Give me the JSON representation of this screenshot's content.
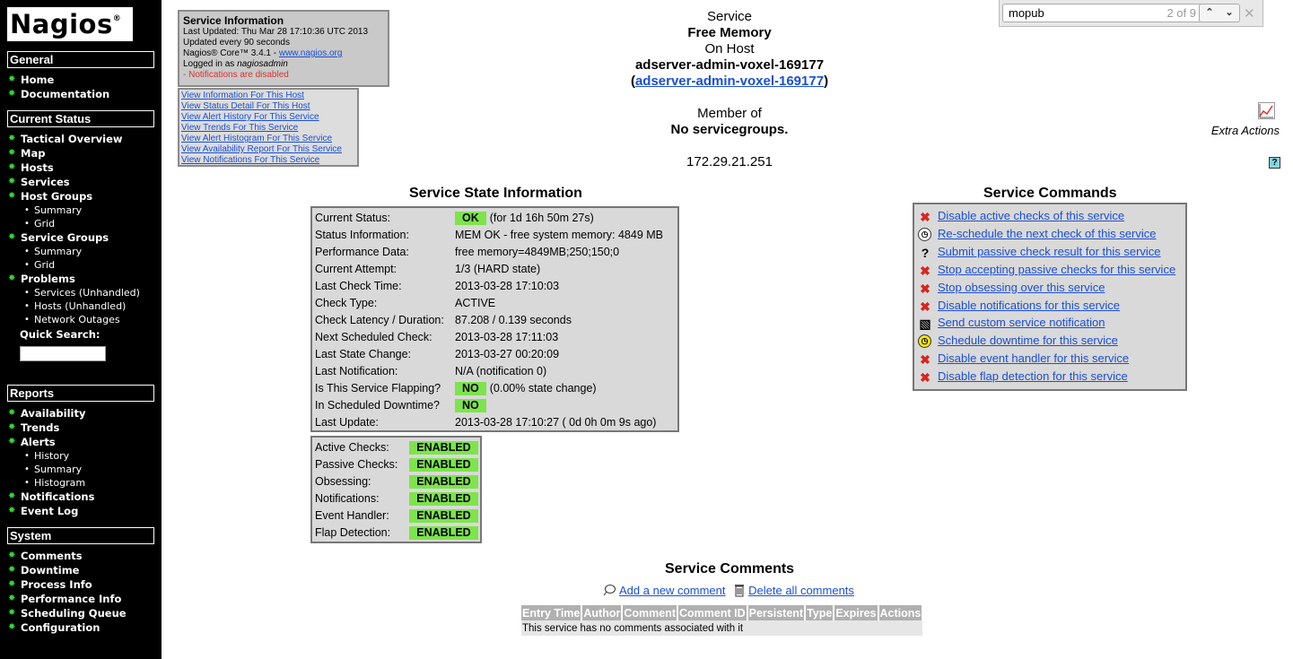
{
  "sidebar": {
    "logo": "Nagios",
    "logo_mark": "®",
    "sections": {
      "general": "General",
      "current_status": "Current Status",
      "reports": "Reports",
      "system": "System"
    },
    "general_items": [
      "Home",
      "Documentation"
    ],
    "current_status_items": [
      {
        "label": "Tactical Overview",
        "sub": false
      },
      {
        "label": "Map",
        "sub": false
      },
      {
        "label": "Hosts",
        "sub": false
      },
      {
        "label": "Services",
        "sub": false
      },
      {
        "label": "Host Groups",
        "sub": false
      },
      {
        "label": "Summary",
        "sub": true
      },
      {
        "label": "Grid",
        "sub": true
      },
      {
        "label": "Service Groups",
        "sub": false
      },
      {
        "label": "Summary",
        "sub": true
      },
      {
        "label": "Grid",
        "sub": true
      },
      {
        "label": "Problems",
        "sub": false
      },
      {
        "label": "Services (Unhandled)",
        "sub": true
      },
      {
        "label": "Hosts (Unhandled)",
        "sub": true
      },
      {
        "label": "Network Outages",
        "sub": true
      }
    ],
    "quick_search_label": "Quick Search:",
    "quick_search_value": "",
    "reports_items": [
      {
        "label": "Availability",
        "sub": false
      },
      {
        "label": "Trends",
        "sub": false
      },
      {
        "label": "Alerts",
        "sub": false
      },
      {
        "label": "History",
        "sub": true
      },
      {
        "label": "Summary",
        "sub": true
      },
      {
        "label": "Histogram",
        "sub": true
      },
      {
        "label": "Notifications",
        "sub": false
      },
      {
        "label": "Event Log",
        "sub": false
      }
    ],
    "system_items": [
      "Comments",
      "Downtime",
      "Process Info",
      "Performance Info",
      "Scheduling Queue",
      "Configuration"
    ]
  },
  "info": {
    "title": "Service Information",
    "last_updated": "Last Updated: Thu Mar 28 17:10:36 UTC 2013",
    "update_freq": "Updated every 90 seconds",
    "core_prefix": "Nagios® Core™ 3.4.1 - ",
    "core_link": "www.nagios.org",
    "logged_prefix": "Logged in as ",
    "logged_user": "nagiosadmin",
    "notifications_warning": "- Notifications are disabled"
  },
  "links": [
    "View Information For This Host",
    "View Status Detail For This Host",
    "View Alert History For This Service",
    "View Trends For This Service",
    "View Alert Histogram For This Service",
    "View Availability Report For This Service",
    "View Notifications For This Service"
  ],
  "header": {
    "service_label": "Service",
    "service_name": "Free Memory",
    "on_host": "On Host",
    "host_name": "adserver-admin-voxel-169177",
    "host_link": "adserver-admin-voxel-169177",
    "paren_open": "(",
    "paren_close": ")",
    "member_of": "Member of",
    "servicegroups": "No servicegroups.",
    "address": "172.29.21.251"
  },
  "findbar": {
    "query": "mopub",
    "count": "2 of 9",
    "prev": "⌃",
    "next": "⌄",
    "close": "✕"
  },
  "extra_actions": "Extra Actions",
  "help_glyph": "?",
  "state": {
    "title": "Service State Information",
    "rows": [
      {
        "label": "Current Status:",
        "badge": "OK",
        "value": "(for 1d 16h 50m 27s)"
      },
      {
        "label": "Status Information:",
        "value": "MEM OK - free system memory: 4849 MB"
      },
      {
        "label": "Performance Data:",
        "value": "free memory=4849MB;250;150;0"
      },
      {
        "label": "Current Attempt:",
        "value": "1/3  (HARD state)"
      },
      {
        "label": "Last Check Time:",
        "value": "2013-03-28 17:10:03"
      },
      {
        "label": "Check Type:",
        "value": "ACTIVE"
      },
      {
        "label": "Check Latency / Duration:",
        "value": "87.208 / 0.139 seconds"
      },
      {
        "label": "Next Scheduled Check:",
        "value": "2013-03-28 17:11:03"
      },
      {
        "label": "Last State Change:",
        "value": "2013-03-27 00:20:09"
      },
      {
        "label": "Last Notification:",
        "value": "N/A (notification 0)"
      },
      {
        "label": "Is This Service Flapping?",
        "badge": "NO",
        "value": "(0.00% state change)"
      },
      {
        "label": "In Scheduled Downtime?",
        "badge": "NO",
        "value": ""
      },
      {
        "label": "Last Update:",
        "value": "2013-03-28 17:10:27  ( 0d 0h 0m 9s ago)"
      }
    ],
    "ok_color": "#7de44b"
  },
  "flags": [
    {
      "label": "Active Checks:",
      "value": "ENABLED"
    },
    {
      "label": "Passive Checks:",
      "value": "ENABLED"
    },
    {
      "label": "Obsessing:",
      "value": "ENABLED"
    },
    {
      "label": "Notifications:",
      "value": "ENABLED"
    },
    {
      "label": "Event Handler:",
      "value": "ENABLED"
    },
    {
      "label": "Flap Detection:",
      "value": "ENABLED"
    }
  ],
  "commands": {
    "title": "Service Commands",
    "items": [
      {
        "icon": "disable-x-icon",
        "label": "Disable active checks of this service"
      },
      {
        "icon": "clock-icon",
        "label": "Re-schedule the next check of this service"
      },
      {
        "icon": "question-icon",
        "label": "Submit passive check result for this service"
      },
      {
        "icon": "disable-x-icon",
        "label": "Stop accepting passive checks for this service"
      },
      {
        "icon": "disable-x-icon",
        "label": "Stop obsessing over this service"
      },
      {
        "icon": "disable-x-icon",
        "label": "Disable notifications for this service"
      },
      {
        "icon": "notify-icon",
        "label": "Send custom service notification"
      },
      {
        "icon": "downtime-clock-icon",
        "label": "Schedule downtime for this service"
      },
      {
        "icon": "disable-x-icon",
        "label": "Disable event handler for this service"
      },
      {
        "icon": "disable-x-icon",
        "label": "Disable flap detection for this service"
      }
    ]
  },
  "comments": {
    "title": "Service Comments",
    "add_label": "Add a new comment",
    "delete_label": "Delete all comments",
    "columns": [
      "Entry Time",
      "Author",
      "Comment",
      "Comment ID",
      "Persistent",
      "Type",
      "Expires",
      "Actions"
    ],
    "empty_message": "This service has no comments associated with it"
  }
}
